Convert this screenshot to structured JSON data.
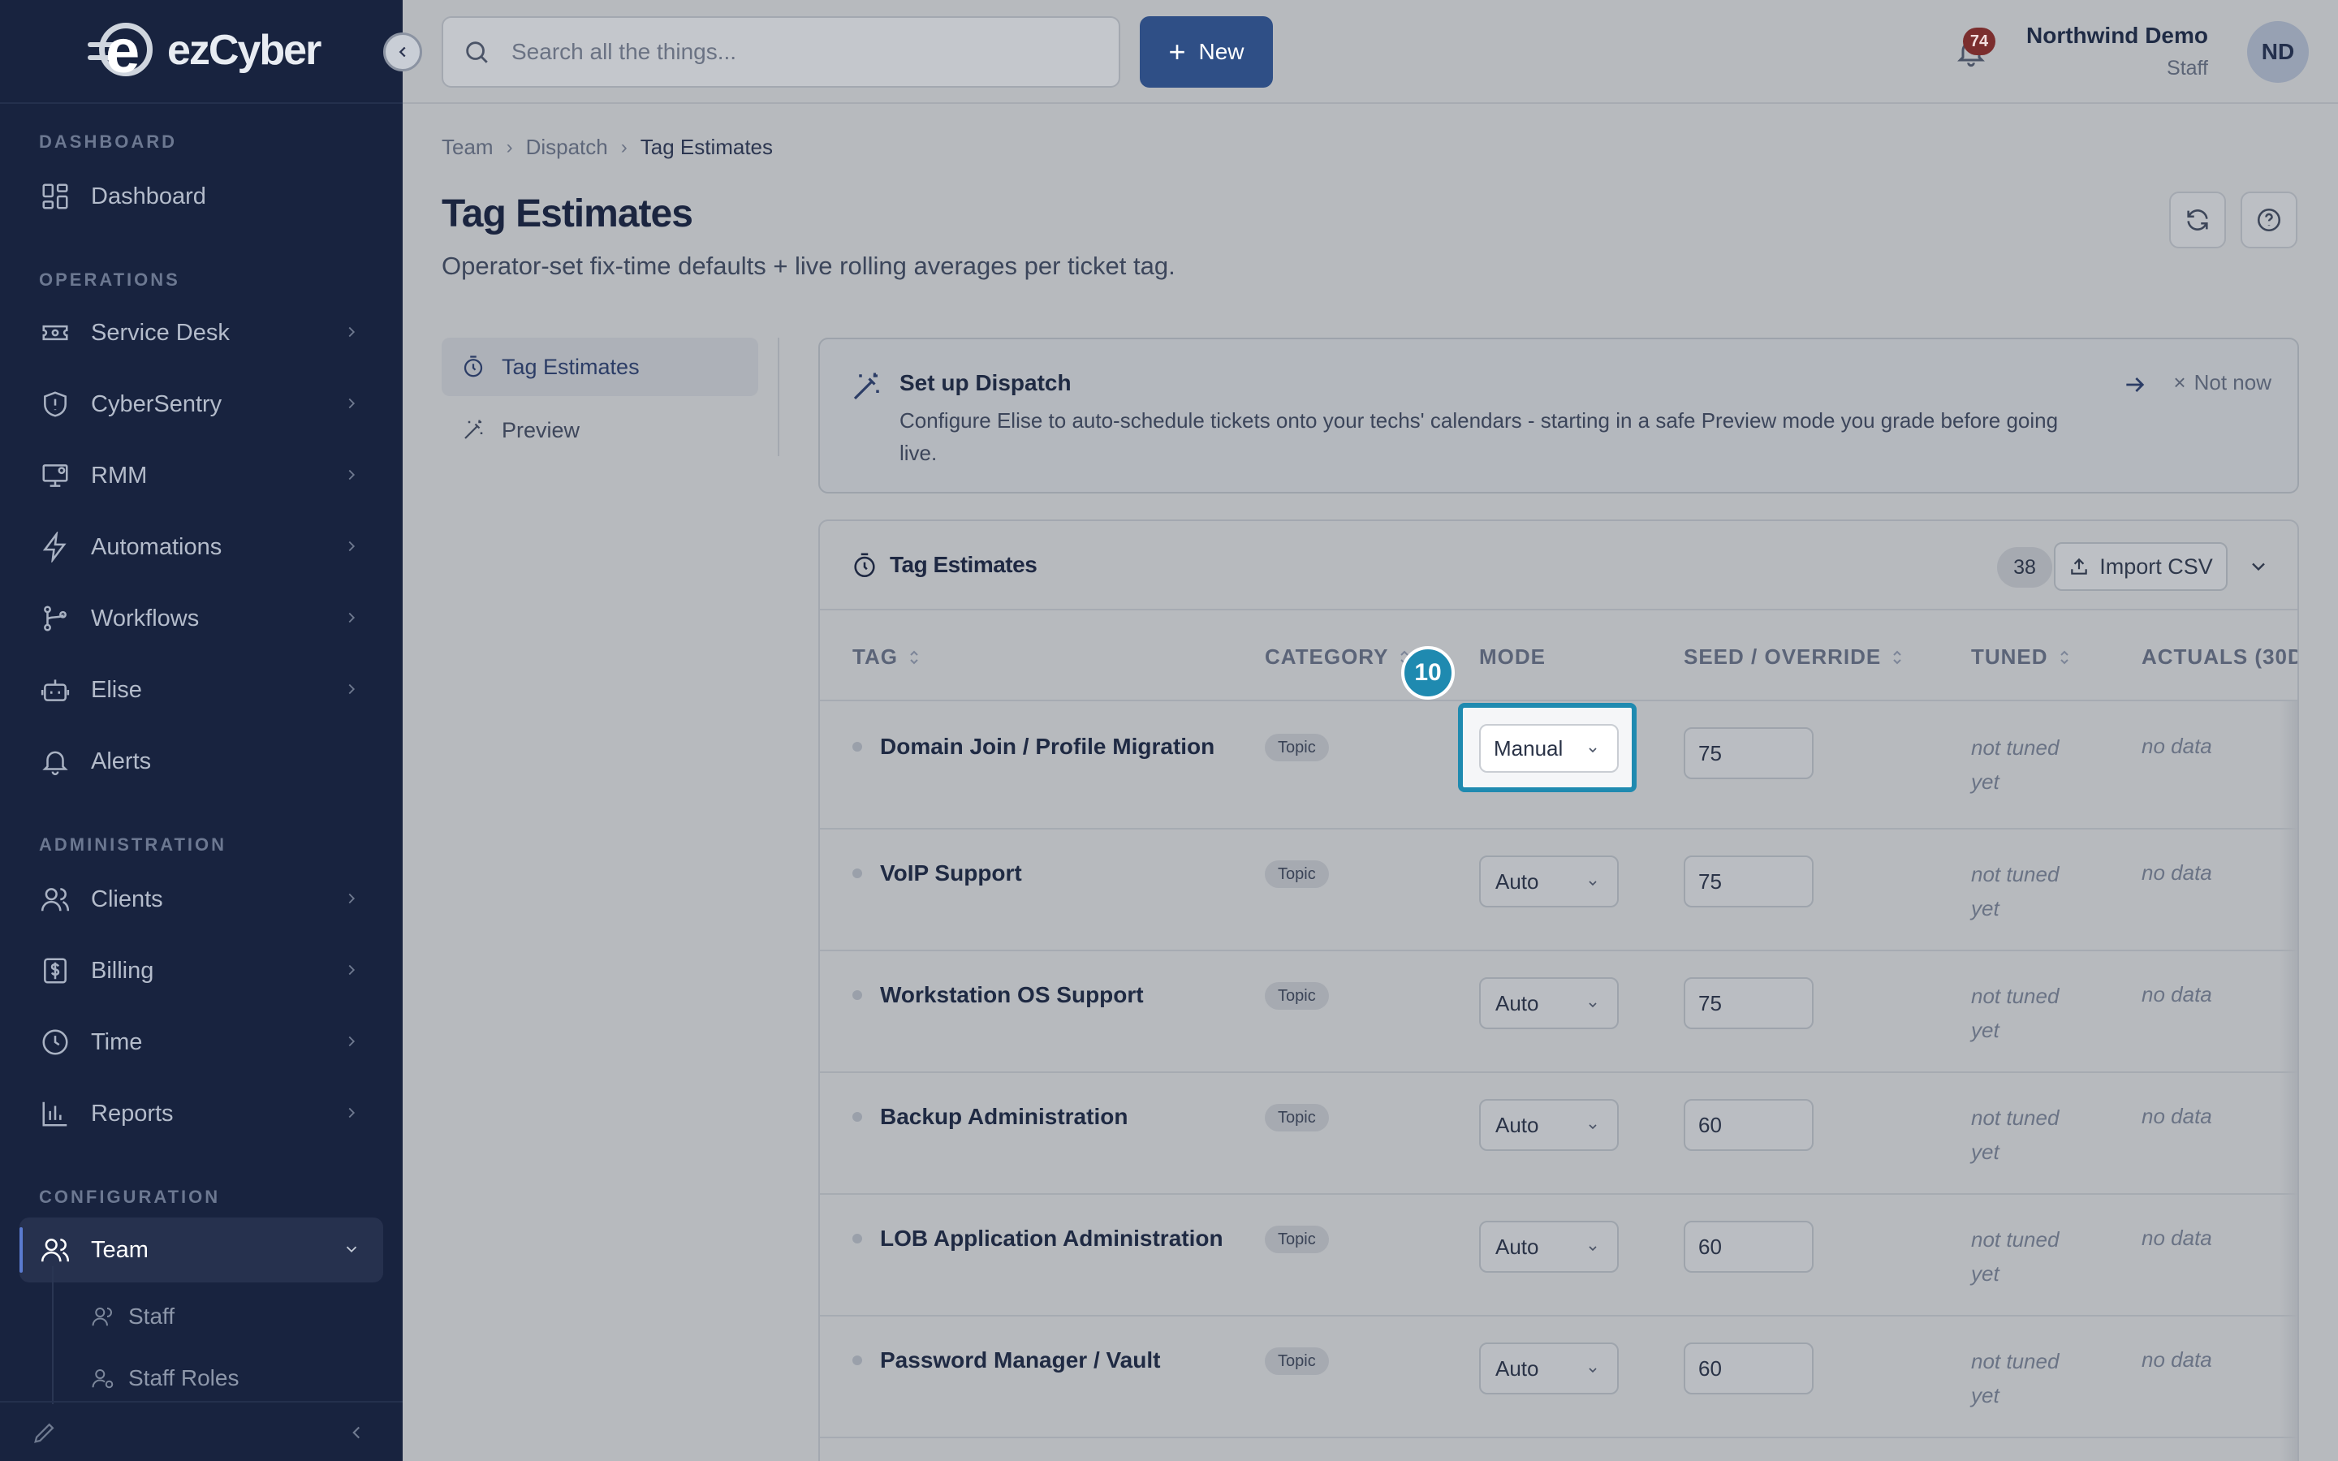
{
  "app": {
    "logo_text": "ezCyber"
  },
  "sidebar": {
    "sections": {
      "dashboard": "DASHBOARD",
      "operations": "OPERATIONS",
      "administration": "ADMINISTRATION",
      "configuration": "CONFIGURATION"
    },
    "items": [
      {
        "label": "Dashboard",
        "icon": "dashboard-icon"
      },
      {
        "label": "Service Desk",
        "icon": "ticket-icon"
      },
      {
        "label": "CyberSentry",
        "icon": "shield-icon"
      },
      {
        "label": "RMM",
        "icon": "monitor-icon"
      },
      {
        "label": "Automations",
        "icon": "lightning-icon"
      },
      {
        "label": "Workflows",
        "icon": "workflow-icon"
      },
      {
        "label": "Elise",
        "icon": "robot-icon"
      },
      {
        "label": "Alerts",
        "icon": "bell-icon"
      },
      {
        "label": "Clients",
        "icon": "users-icon"
      },
      {
        "label": "Billing",
        "icon": "dollar-icon"
      },
      {
        "label": "Time",
        "icon": "clock-icon"
      },
      {
        "label": "Reports",
        "icon": "bar-chart-icon"
      },
      {
        "label": "Team",
        "icon": "team-icon"
      }
    ],
    "sub_items": [
      {
        "label": "Staff"
      },
      {
        "label": "Staff Roles"
      }
    ]
  },
  "topbar": {
    "search_placeholder": "Search all the things...",
    "new_label": "New",
    "notification_count": "74",
    "user_name": "Northwind Demo",
    "user_role": "Staff",
    "avatar_initials": "ND"
  },
  "breadcrumb": [
    "Team",
    "Dispatch",
    "Tag Estimates"
  ],
  "page": {
    "title": "Tag Estimates",
    "subtitle": "Operator-set fix-time defaults + live rolling averages per ticket tag."
  },
  "tabs": [
    {
      "label": "Tag Estimates",
      "active": true
    },
    {
      "label": "Preview",
      "active": false
    }
  ],
  "banner": {
    "title": "Set up Dispatch",
    "text": "Configure Elise to auto-schedule tickets onto your techs' calendars - starting in a safe Preview mode you grade before going live.",
    "dismiss_label": "Not now"
  },
  "card": {
    "title": "Tag Estimates",
    "count": "38",
    "import_label": "Import CSV"
  },
  "table": {
    "columns": [
      "TAG",
      "CATEGORY",
      "MODE",
      "SEED / OVERRIDE",
      "TUNED",
      "ACTUALS (30D"
    ],
    "rows": [
      {
        "tag": "Domain Join / Profile Migration",
        "category": "Topic",
        "mode": "Manual",
        "seed": "75",
        "tuned": "not tuned yet",
        "actuals": "no data"
      },
      {
        "tag": "VoIP Support",
        "category": "Topic",
        "mode": "Auto",
        "seed": "75",
        "tuned": "not tuned yet",
        "actuals": "no data"
      },
      {
        "tag": "Workstation OS Support",
        "category": "Topic",
        "mode": "Auto",
        "seed": "75",
        "tuned": "not tuned yet",
        "actuals": "no data"
      },
      {
        "tag": "Backup Administration",
        "category": "Topic",
        "mode": "Auto",
        "seed": "60",
        "tuned": "not tuned yet",
        "actuals": "no data"
      },
      {
        "tag": "LOB Application Administration",
        "category": "Topic",
        "mode": "Auto",
        "seed": "60",
        "tuned": "not tuned yet",
        "actuals": "no data"
      },
      {
        "tag": "Password Manager / Vault",
        "category": "Topic",
        "mode": "Auto",
        "seed": "60",
        "tuned": "not tuned yet",
        "actuals": "no data"
      }
    ]
  },
  "highlight": {
    "step_number": "10"
  },
  "colors": {
    "sidebar_bg": "#18233f",
    "primary_button": "#2f4f86",
    "highlight": "#1f8ab0",
    "page_bg": "#b7babe"
  }
}
